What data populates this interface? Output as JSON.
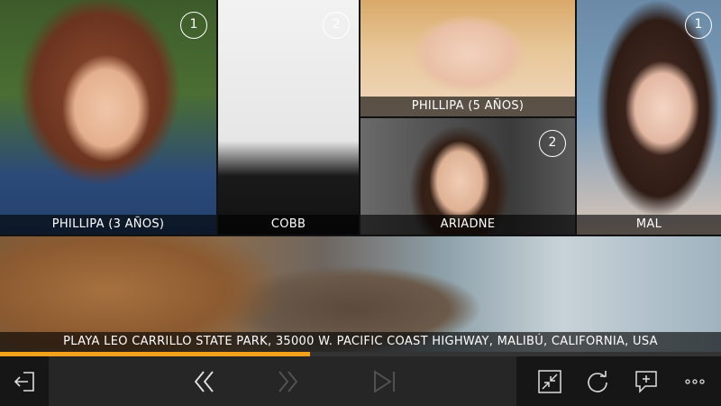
{
  "tiles": [
    {
      "id": "t1",
      "caption": "PHILLIPA (3 AÑOS)",
      "badge": "1"
    },
    {
      "id": "t2",
      "caption": "COBB",
      "badge": "2"
    },
    {
      "id": "t3",
      "caption": "PHILLIPA (5 AÑOS)",
      "badge": ""
    },
    {
      "id": "t4",
      "caption": "ARIADNE",
      "badge": "2"
    },
    {
      "id": "t5",
      "caption": "MAL",
      "badge": "1"
    },
    {
      "id": "t6",
      "caption": "PLAYA LEO CARRILLO STATE PARK,  35000 W. PACIFIC COAST HIGHWAY, MALIBÚ, CALIFORNIA, USA",
      "badge": ""
    }
  ],
  "playback": {
    "progress_fraction": 0.43
  },
  "appbar": {
    "buttons": [
      {
        "icon": "exit-icon"
      },
      {
        "icon": "rewind-icon"
      },
      {
        "icon": "fast-forward-icon",
        "disabled": true
      },
      {
        "icon": "skip-next-icon",
        "disabled": true
      },
      {
        "icon": "collapse-icon"
      },
      {
        "icon": "refresh-icon"
      },
      {
        "icon": "add-comment-icon"
      },
      {
        "icon": "more-options-icon"
      }
    ]
  },
  "colors": {
    "accent": "#f2a21a",
    "bar": "#1f1f1f",
    "panel_dark": "#161616",
    "panel_mid": "#262626"
  }
}
